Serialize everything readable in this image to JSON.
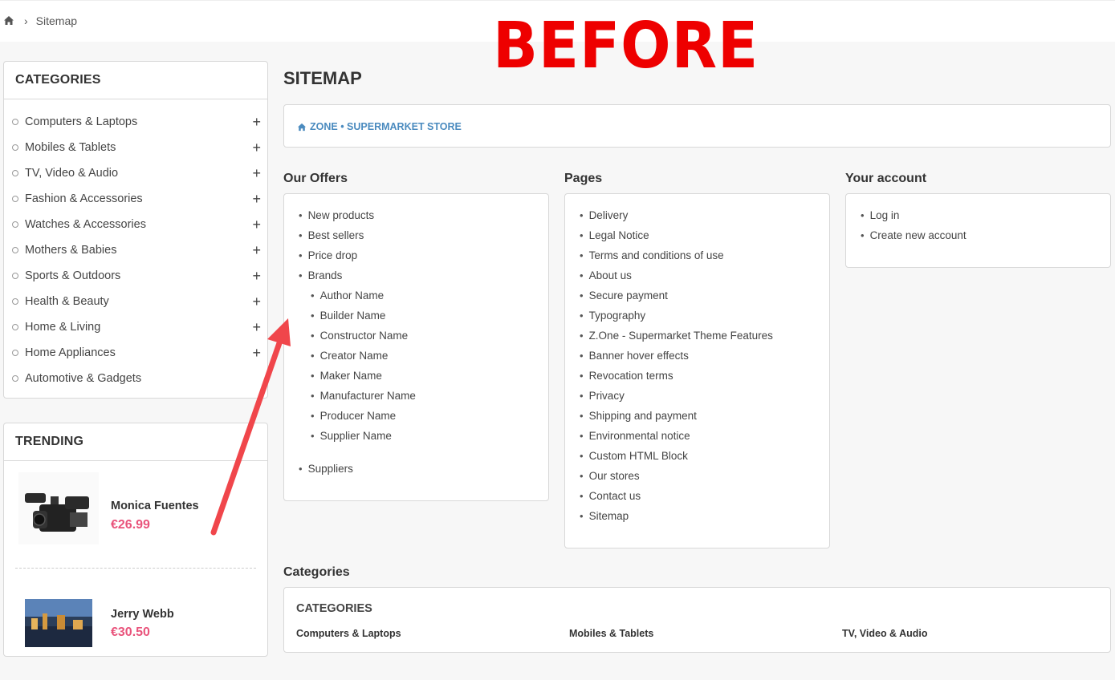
{
  "breadcrumb": {
    "home_icon": "home-icon",
    "separator": "›",
    "current": "Sitemap"
  },
  "annotation": {
    "label": "BEFORE",
    "color": "#ee0000",
    "arrow_color": "#f0464b"
  },
  "sidebar": {
    "categories_title": "CATEGORIES",
    "categories": [
      {
        "label": "Computers & Laptops",
        "expand": "+"
      },
      {
        "label": "Mobiles & Tablets",
        "expand": "+"
      },
      {
        "label": "TV, Video & Audio",
        "expand": "+"
      },
      {
        "label": "Fashion & Accessories",
        "expand": "+"
      },
      {
        "label": "Watches & Accessories",
        "expand": "+"
      },
      {
        "label": "Mothers & Babies",
        "expand": "+"
      },
      {
        "label": "Sports & Outdoors",
        "expand": "+"
      },
      {
        "label": "Health & Beauty",
        "expand": "+"
      },
      {
        "label": "Home & Living",
        "expand": "+"
      },
      {
        "label": "Home Appliances",
        "expand": "+"
      },
      {
        "label": "Automotive & Gadgets",
        "expand": ""
      }
    ],
    "trending_title": "TRENDING",
    "trending": [
      {
        "name": "Monica Fuentes",
        "price": "€26.99",
        "image": "camcorder-image"
      },
      {
        "name": "Jerry Webb",
        "price": "€30.50",
        "image": "city-tv-image"
      }
    ]
  },
  "main": {
    "title": "SITEMAP",
    "store_link": "ZONE • SUPERMARKET STORE",
    "offers": {
      "title": "Our Offers",
      "items": [
        {
          "label": "New products",
          "level": 0
        },
        {
          "label": "Best sellers",
          "level": 0
        },
        {
          "label": "Price drop",
          "level": 0
        },
        {
          "label": "Brands",
          "level": 0
        },
        {
          "label": "Author Name",
          "level": 1
        },
        {
          "label": "Builder Name",
          "level": 1
        },
        {
          "label": "Constructor Name",
          "level": 1
        },
        {
          "label": "Creator Name",
          "level": 1
        },
        {
          "label": "Maker Name",
          "level": 1
        },
        {
          "label": "Manufacturer Name",
          "level": 1
        },
        {
          "label": "Producer Name",
          "level": 1
        },
        {
          "label": "Supplier Name",
          "level": 1
        },
        {
          "label": "Suppliers",
          "level": 0
        }
      ]
    },
    "pages": {
      "title": "Pages",
      "items": [
        "Delivery",
        "Legal Notice",
        "Terms and conditions of use",
        "About us",
        "Secure payment",
        "Typography",
        "Z.One - Supermarket Theme Features",
        "Banner hover effects",
        "Revocation terms",
        "Privacy",
        "Shipping and payment",
        "Environmental notice",
        "Custom HTML Block",
        "Our stores",
        "Contact us",
        "Sitemap"
      ]
    },
    "account": {
      "title": "Your account",
      "items": [
        "Log in",
        "Create new account"
      ]
    },
    "categories": {
      "title": "Categories",
      "box_title": "CATEGORIES",
      "columns": [
        "Computers & Laptops",
        "Mobiles & Tablets",
        "TV, Video & Audio"
      ]
    }
  },
  "colors": {
    "price": "#e9537b",
    "link": "#4b8bbf",
    "border": "#d8d8d8"
  }
}
